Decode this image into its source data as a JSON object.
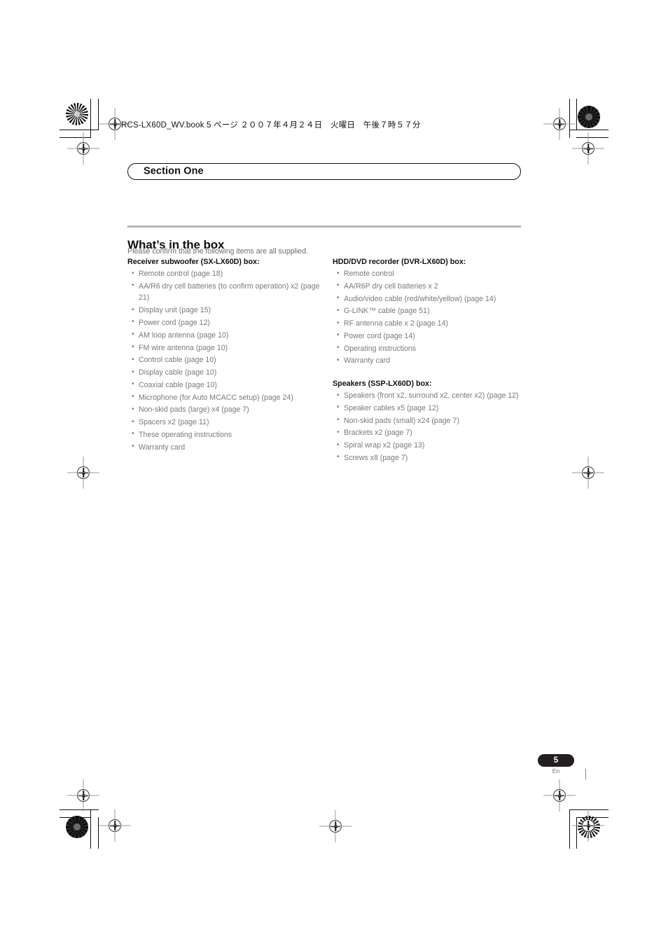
{
  "header": {
    "book_line": "RCS-LX60D_WV.book 5 ページ  ２００７年４月２４日　火曜日　午後７時５７分"
  },
  "section": {
    "banner_label": "Section One"
  },
  "main": {
    "title": "What’s in the box",
    "intro": "Please confirm that the following items are all supplied.",
    "columns": [
      {
        "groups": [
          {
            "title": "Receiver subwoofer (SX-LX60D) box:",
            "items": [
              "Remote control (page 18)",
              "AA/R6 dry cell batteries (to confirm operation) x2 (page 21)",
              "Display unit (page 15)",
              "Power cord (page 12)",
              "AM loop antenna (page 10)",
              "FM wire antenna (page 10)",
              "Control cable (page 10)",
              "Display cable (page 10)",
              "Coaxial cable (page 10)",
              "Microphone (for Auto MCACC setup) (page 24)",
              "Non-skid pads (large) x4 (page 7)",
              "Spacers x2 (page 11)",
              "These operating instructions",
              "Warranty card"
            ]
          }
        ]
      },
      {
        "groups": [
          {
            "title": "HDD/DVD recorder (DVR-LX60D) box:",
            "items": [
              "Remote control",
              "AA/R6P dry cell batteries x 2",
              "Audio/video cable (red/white/yellow) (page 14)",
              "G-LINK™ cable (page 51)",
              "RF antenna cable x 2 (page 14)",
              "Power cord (page 14)",
              "Operating instructions",
              "Warranty card"
            ]
          },
          {
            "title": "Speakers (SSP-LX60D) box:",
            "items": [
              "Speakers (front x2, surround x2, center x2) (page 12)",
              "Speaker cables x5 (page 12)",
              "Non-skid pads (small) x24 (page 7)",
              "Brackets x2 (page 7)",
              "Spiral wrap x2 (page 13)",
              "Screws x8 (page 7)"
            ]
          }
        ]
      }
    ]
  },
  "footer": {
    "page_number": "5",
    "language": "En"
  },
  "colors": {
    "text_dark": "#111111",
    "text_gray": "#7a7a7a",
    "rule_gray": "#b5b5b5",
    "badge_dark": "#231f20"
  }
}
